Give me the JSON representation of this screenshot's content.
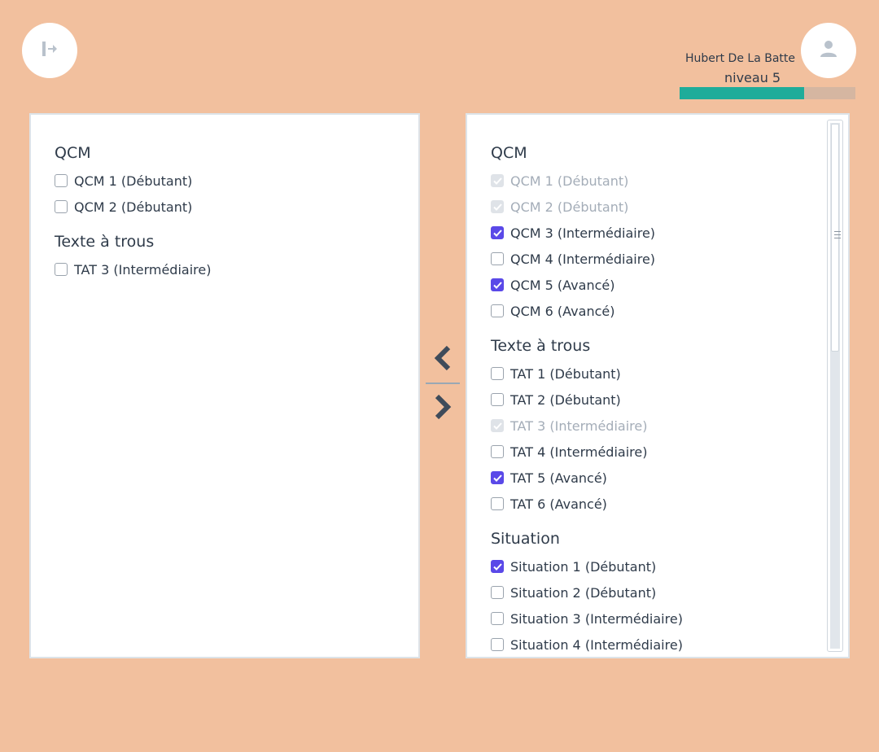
{
  "header": {
    "user_name": "Hubert De La Batte",
    "user_level": "niveau 5",
    "level_progress_percent": 71,
    "icons": {
      "logout": "logout-icon",
      "avatar": "user-icon"
    }
  },
  "colors": {
    "background": "#f2c09e",
    "progress_fill": "#1fac9a",
    "progress_track": "#d5b6a1",
    "checkbox_checked": "#5a49e8",
    "text": "#2f3b4a",
    "text_disabled": "#a4adb8"
  },
  "left_panel": {
    "groups": [
      {
        "title": "QCM",
        "items": [
          {
            "label": "QCM 1 (Débutant)",
            "state": "unchecked"
          },
          {
            "label": "QCM 2 (Débutant)",
            "state": "unchecked"
          }
        ]
      },
      {
        "title": "Texte à trous",
        "items": [
          {
            "label": "TAT 3 (Intermédiaire)",
            "state": "unchecked"
          }
        ]
      }
    ]
  },
  "transfer": {
    "left_icon": "chevron-left-icon",
    "right_icon": "chevron-right-icon"
  },
  "right_panel": {
    "groups": [
      {
        "title": "QCM",
        "items": [
          {
            "label": "QCM 1 (Débutant)",
            "state": "disabled-checked"
          },
          {
            "label": "QCM 2 (Débutant)",
            "state": "disabled-checked"
          },
          {
            "label": "QCM 3 (Intermédiaire)",
            "state": "checked"
          },
          {
            "label": "QCM 4 (Intermédiaire)",
            "state": "unchecked"
          },
          {
            "label": "QCM 5 (Avancé)",
            "state": "checked"
          },
          {
            "label": "QCM 6 (Avancé)",
            "state": "unchecked"
          }
        ]
      },
      {
        "title": "Texte à trous",
        "items": [
          {
            "label": "TAT 1 (Débutant)",
            "state": "unchecked"
          },
          {
            "label": "TAT 2 (Débutant)",
            "state": "unchecked"
          },
          {
            "label": "TAT 3 (Intermédiaire)",
            "state": "disabled-checked"
          },
          {
            "label": "TAT 4 (Intermédiaire)",
            "state": "unchecked"
          },
          {
            "label": "TAT 5 (Avancé)",
            "state": "checked"
          },
          {
            "label": "TAT 6 (Avancé)",
            "state": "unchecked"
          }
        ]
      },
      {
        "title": "Situation",
        "items": [
          {
            "label": "Situation 1 (Débutant)",
            "state": "checked"
          },
          {
            "label": "Situation 2 (Débutant)",
            "state": "unchecked"
          },
          {
            "label": "Situation 3 (Intermédiaire)",
            "state": "unchecked"
          },
          {
            "label": "Situation 4 (Intermédiaire)",
            "state": "unchecked"
          }
        ]
      }
    ]
  }
}
